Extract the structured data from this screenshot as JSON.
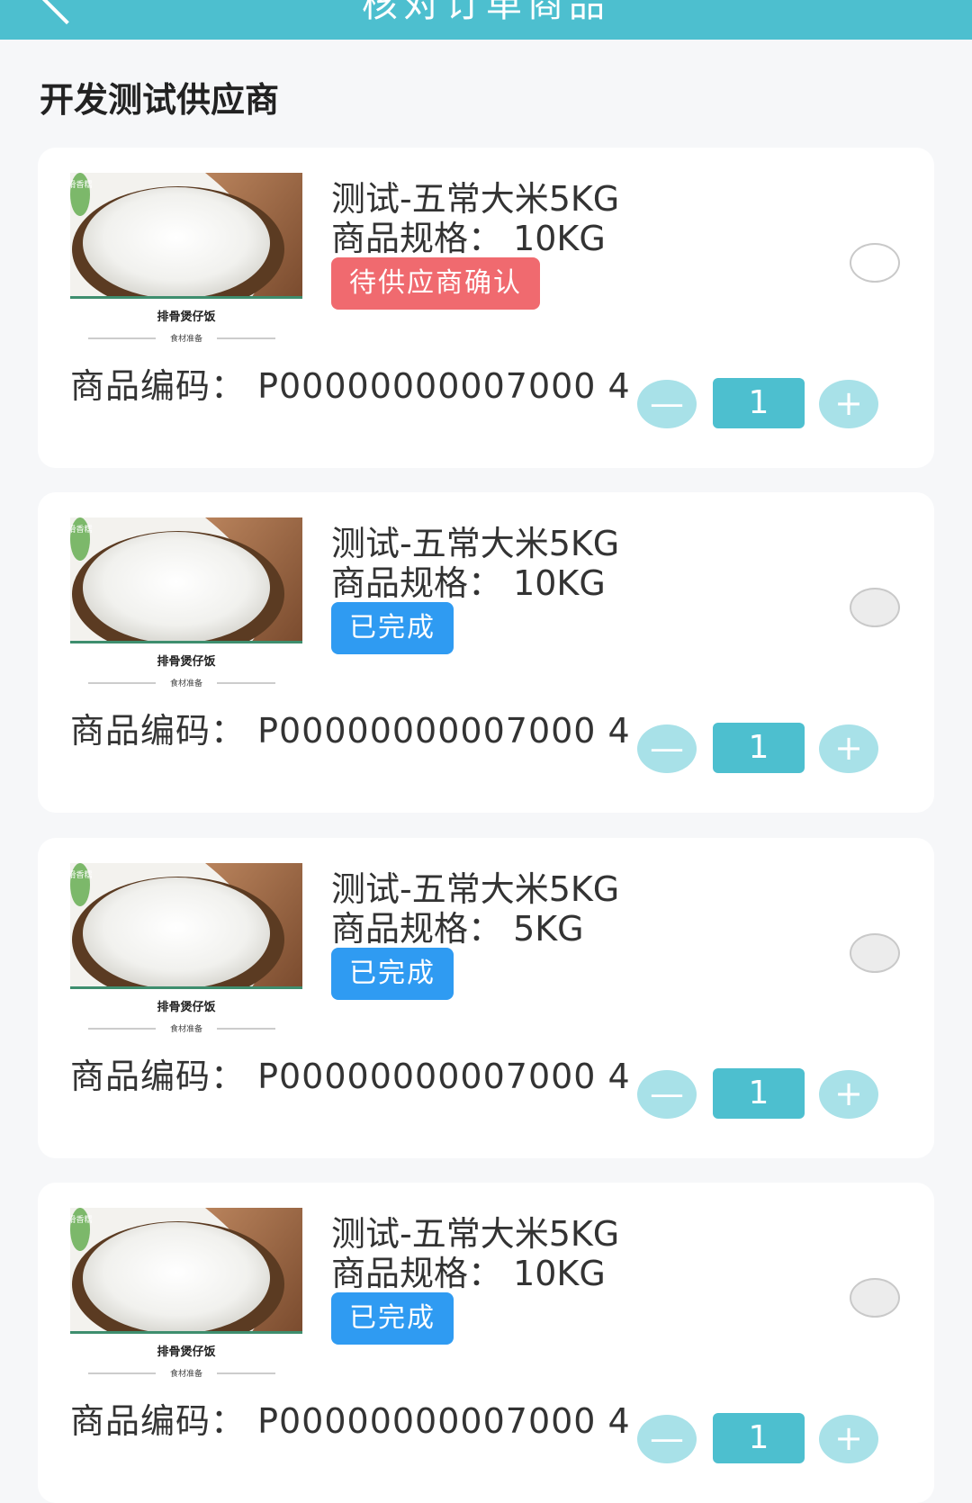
{
  "header": {
    "title": "核对订单商品"
  },
  "supplier": {
    "name": "开发测试供应商"
  },
  "items": [
    {
      "name": "测试-五常大米5KG",
      "spec": "商品规格：  10KG",
      "status": "待供应商确认",
      "status_color": "#f06a6f",
      "code": "商品编码：  P00000000007000 4",
      "quantity": "1",
      "minus_label": "—",
      "plus_label": "+",
      "image_caption": "排骨煲仔饭",
      "image_subcaption": "食材准备",
      "image_badge": "滑香糯"
    },
    {
      "name": "测试-五常大米5KG",
      "spec": "商品规格：  10KG",
      "status": "已完成",
      "status_color": "#2f9bf2",
      "code": "商品编码：  P00000000007000 4",
      "quantity": "1",
      "minus_label": "—",
      "plus_label": "+",
      "image_caption": "排骨煲仔饭",
      "image_subcaption": "食材准备",
      "image_badge": "滑香糯"
    },
    {
      "name": "测试-五常大米5KG",
      "spec": "商品规格：  5KG",
      "status": "已完成",
      "status_color": "#2f9bf2",
      "code": "商品编码：  P00000000007000 4",
      "quantity": "1",
      "minus_label": "—",
      "plus_label": "+",
      "image_caption": "排骨煲仔饭",
      "image_subcaption": "食材准备",
      "image_badge": "滑香糯"
    },
    {
      "name": "测试-五常大米5KG",
      "spec": "商品规格：  10KG",
      "status": "已完成",
      "status_color": "#2f9bf2",
      "code": "商品编码：  P00000000007000 4",
      "quantity": "1",
      "minus_label": "—",
      "plus_label": "+",
      "image_caption": "排骨煲仔饭",
      "image_subcaption": "食材准备",
      "image_badge": "滑香糯"
    }
  ]
}
